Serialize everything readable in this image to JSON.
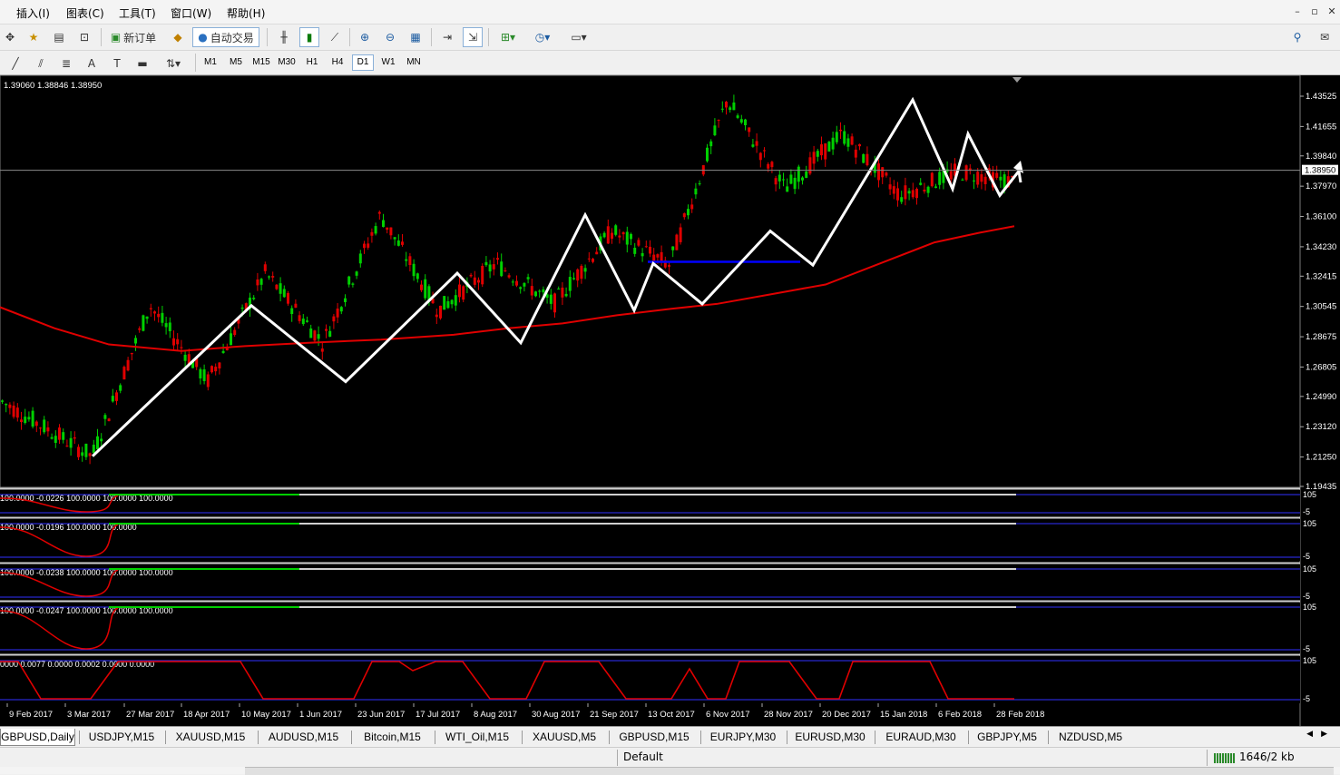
{
  "menu": [
    "插入(I)",
    "图表(C)",
    "工具(T)",
    "窗口(W)",
    "帮助(H)"
  ],
  "toolbar": {
    "new_order": "新订单",
    "auto_trade": "自动交易",
    "timeframes": [
      "M1",
      "M5",
      "M15",
      "M30",
      "H1",
      "H4",
      "D1",
      "W1",
      "MN"
    ],
    "selected_timeframe": "D1"
  },
  "chart": {
    "info": "1.39060 1.38846 1.38950",
    "current_price": "1.38950",
    "price_axis": [
      "1.43525",
      "1.41655",
      "1.39840",
      "1.37970",
      "1.36100",
      "1.34230",
      "1.32415",
      "1.30545",
      "1.28675",
      "1.26805",
      "1.24990",
      "1.23120",
      "1.21250",
      "1.19435"
    ],
    "time_axis": [
      "9 Feb 2017",
      "3 Mar 2017",
      "27 Mar 2017",
      "18 Apr 2017",
      "10 May 2017",
      "1 Jun 2017",
      "23 Jun 2017",
      "17 Jul 2017",
      "8 Aug 2017",
      "30 Aug 2017",
      "21 Sep 2017",
      "13 Oct 2017",
      "6 Nov 2017",
      "28 Nov 2017",
      "20 Dec 2017",
      "15 Jan 2018",
      "6 Feb 2018",
      "28 Feb 2018"
    ],
    "colors": {
      "bull": "#00d000",
      "bear": "#e00000",
      "ma": "#e00000",
      "zigzag": "#ffffff",
      "hline": "#0000ff"
    }
  },
  "subwindows": [
    {
      "label": "100.0000 -0.0226 100.0000 100.0000 100.0000",
      "top_level": "105",
      "bottom_level": "-5"
    },
    {
      "label": "100.0000 -0.0196 100.0000 100.0000",
      "top_level": "105",
      "bottom_level": "-5"
    },
    {
      "label": "100.0000 -0.0238 100.0000 100.0000 100.0000",
      "top_level": "105",
      "bottom_level": "-5"
    },
    {
      "label": "100.0000 -0.0247 100.0000 100.0000 100.0000",
      "top_level": "105",
      "bottom_level": "-5"
    },
    {
      "label": "0000 0.0077 0.0000 0.0002 0.0000 0.0000",
      "top_level": "105",
      "bottom_level": "-5"
    }
  ],
  "tabs": [
    "GBPUSD,Daily",
    "USDJPY,M15",
    "XAUUSD,M15",
    "AUDUSD,M15",
    "Bitcoin,M15",
    "WTI_Oil,M15",
    "XAUUSD,M5",
    "GBPUSD,M15",
    "EURJPY,M30",
    "EURUSD,M30",
    "EURAUD,M30",
    "GBPJPY,M5",
    "NZDUSD,M5"
  ],
  "active_tab": "GBPUSD,Daily",
  "status": {
    "profile": "Default",
    "traffic": "1646/2 kb"
  },
  "chart_data": {
    "type": "candlestick",
    "symbol": "GBPUSD,Daily",
    "ylim": [
      1.19435,
      1.43525
    ],
    "x": [
      "9 Feb 2017",
      "3 Mar 2017",
      "27 Mar 2017",
      "18 Apr 2017",
      "10 May 2017",
      "1 Jun 2017",
      "23 Jun 2017",
      "17 Jul 2017",
      "8 Aug 2017",
      "30 Aug 2017",
      "21 Sep 2017",
      "13 Oct 2017",
      "6 Nov 2017",
      "28 Nov 2017",
      "20 Dec 2017",
      "15 Jan 2018",
      "6 Feb 2018",
      "28 Feb 2018"
    ],
    "close": [
      1.247,
      1.225,
      1.245,
      1.285,
      1.295,
      1.285,
      1.275,
      1.31,
      1.29,
      1.29,
      1.355,
      1.325,
      1.31,
      1.345,
      1.345,
      1.41,
      1.385,
      1.382
    ],
    "zigzag": [
      1.213,
      1.306,
      1.259,
      1.326,
      1.283,
      1.362,
      1.303,
      1.332,
      1.307,
      1.352,
      1.331,
      1.433,
      1.378,
      1.412,
      1.374,
      1.389,
      1.382
    ],
    "moving_average": [
      1.305,
      1.292,
      1.282,
      1.278,
      1.281,
      1.283,
      1.285,
      1.288,
      1.292,
      1.295,
      1.3,
      1.304,
      1.307,
      1.313,
      1.319,
      1.332,
      1.345,
      1.351,
      1.355
    ],
    "horizontal_line": 1.333
  }
}
